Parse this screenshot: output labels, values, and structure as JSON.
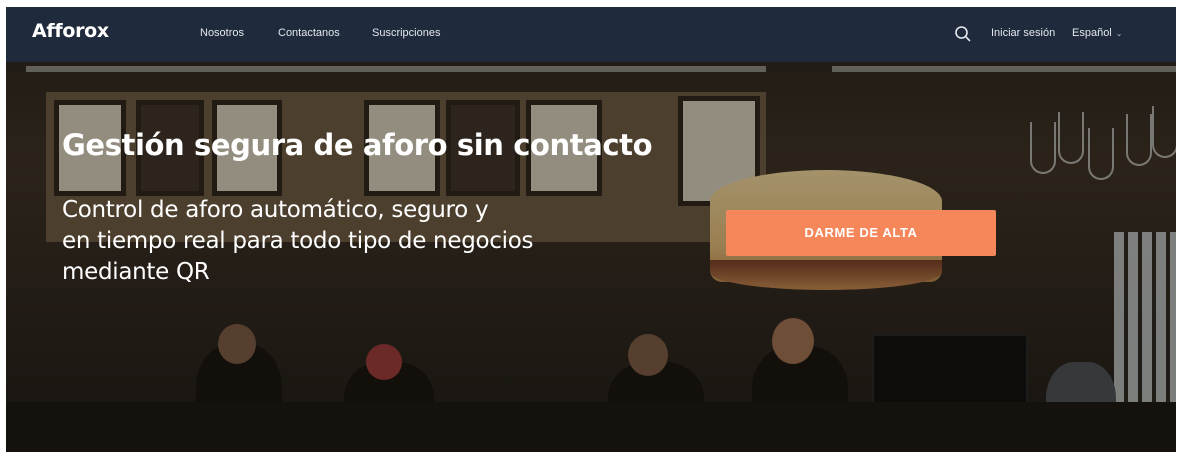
{
  "brand": {
    "logo": "Afforox"
  },
  "nav": {
    "links": [
      {
        "label": "Nosotros"
      },
      {
        "label": "Contactanos"
      },
      {
        "label": "Suscripciones"
      }
    ],
    "search_icon": "search-icon",
    "login_label": "Iniciar sesión",
    "language": {
      "selected": "Español",
      "icon": "chevron-down-icon"
    }
  },
  "hero": {
    "title": "Gestión segura de aforo sin contacto",
    "subtitle_lines": [
      "Control de aforo automático, seguro y",
      "en tiempo real para todo tipo de negocios",
      "mediante QR"
    ],
    "cta_label": "DARME DE ALTA",
    "background_image": "restaurant-bar-photo"
  },
  "colors": {
    "navbar": "#1f2a3c",
    "cta": "#f5875a",
    "text": "#ffffff"
  }
}
